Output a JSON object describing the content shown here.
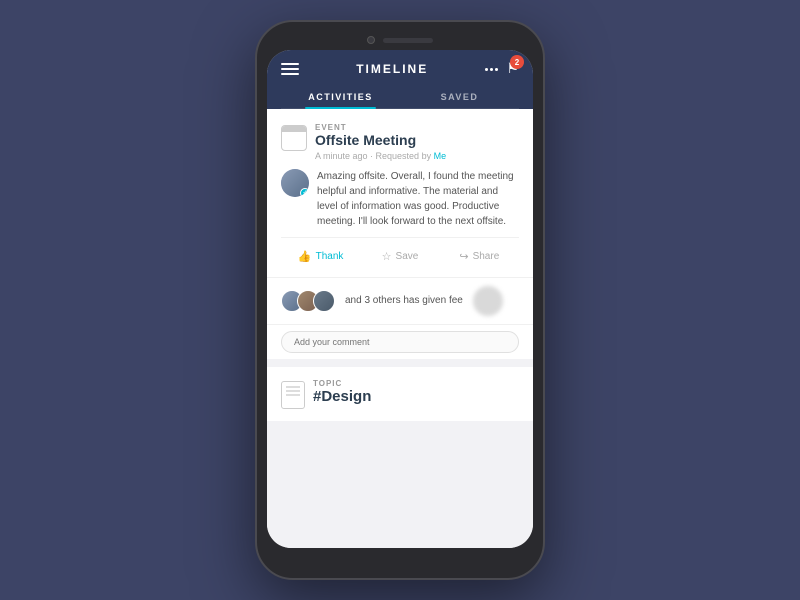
{
  "page": {
    "background": "#3d4466"
  },
  "header": {
    "title": "TIMELINE",
    "notification_count": "2"
  },
  "tabs": [
    {
      "id": "activities",
      "label": "ACTIVITIES",
      "active": true
    },
    {
      "id": "saved",
      "label": "SAVED",
      "active": false
    }
  ],
  "event_card": {
    "type_label": "EVENT",
    "title": "Offsite Meeting",
    "meta": "A minute ago · Requested by",
    "meta_link": "Me",
    "comment": {
      "text": "Amazing offsite. Overall, I found the meeting helpful and informative. The material and level of information was good. Productive meeting. I'll look forward to the next offsite."
    },
    "actions": [
      {
        "id": "thank",
        "label": "Thank",
        "icon": "👍",
        "active": true
      },
      {
        "id": "save",
        "label": "Save",
        "icon": "☆",
        "active": false
      },
      {
        "id": "share",
        "label": "Share",
        "icon": "↪",
        "active": false
      }
    ]
  },
  "feedback_row": {
    "text": "and 3 others has given fee"
  },
  "comment_input": {
    "placeholder": "Add your comment"
  },
  "topic_card": {
    "type_label": "TOPIC",
    "title": "#Design"
  }
}
